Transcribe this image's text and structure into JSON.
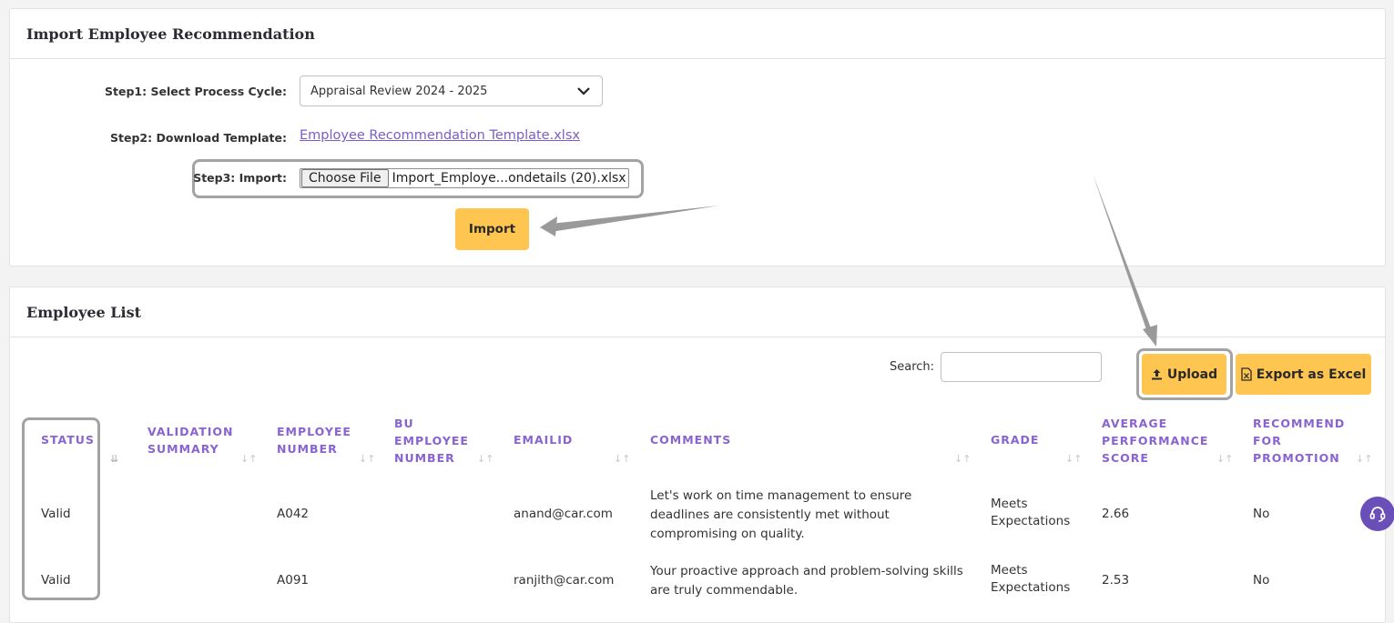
{
  "import_card": {
    "title": "Import Employee Recommendation",
    "step1_label": "Step1: Select Process Cycle:",
    "process_cycle_value": "Appraisal Review 2024 - 2025",
    "step2_label": "Step2: Download Template:",
    "template_link": "Employee Recommendation Template.xlsx",
    "step3_label": "Step3: Import:",
    "choose_file_label": "Choose File",
    "file_name": "Import_Employe...ondetails (20).xlsx",
    "import_button": "Import"
  },
  "list_card": {
    "title": "Employee List",
    "search_label": "Search:",
    "search_value": "",
    "upload_button": "Upload",
    "export_button": "Export as Excel",
    "columns": {
      "status": "STATUS",
      "validation_1": "VALIDATION",
      "validation_2": "SUMMARY",
      "empno_1": "EMPLOYEE",
      "empno_2": "NUMBER",
      "bu_1": "BU",
      "bu_2": "EMPLOYEE",
      "bu_3": "NUMBER",
      "email": "EMAILID",
      "comments": "COMMENTS",
      "grade": "GRADE",
      "avg_1": "AVERAGE",
      "avg_2": "PERFORMANCE",
      "avg_3": "SCORE",
      "rec_1": "RECOMMEND",
      "rec_2": "FOR",
      "rec_3": "PROMOTION"
    },
    "rows": [
      {
        "status": "Valid",
        "validation_summary": "",
        "employee_number": "A042",
        "bu_employee_number": "",
        "email": "anand@car.com",
        "comment_1": "Let's work on time management to ensure",
        "comment_2": "deadlines are consistently met without",
        "comment_3": "compromising on quality.",
        "grade_1": "Meets",
        "grade_2": "Expectations",
        "avg_score": "2.66",
        "recommend": "No"
      },
      {
        "status": "Valid",
        "validation_summary": "",
        "employee_number": "A091",
        "bu_employee_number": "",
        "email": "ranjith@car.com",
        "comment_1": "Your proactive approach and problem-solving skills",
        "comment_2": "are truly commendable.",
        "grade_1": "Meets",
        "grade_2": "Expectations",
        "avg_score": "2.53",
        "recommend": "No"
      }
    ]
  },
  "colors": {
    "accent_yellow": "#ffc551",
    "header_purple": "#8a63d2",
    "link_purple": "#7b5dc8",
    "help_button": "#6b4fb9"
  },
  "icons": {
    "dropdown": "chevron-down-icon",
    "upload": "upload-icon",
    "excel": "excel-file-icon",
    "sort": "sort-icon",
    "help": "headset-icon"
  }
}
